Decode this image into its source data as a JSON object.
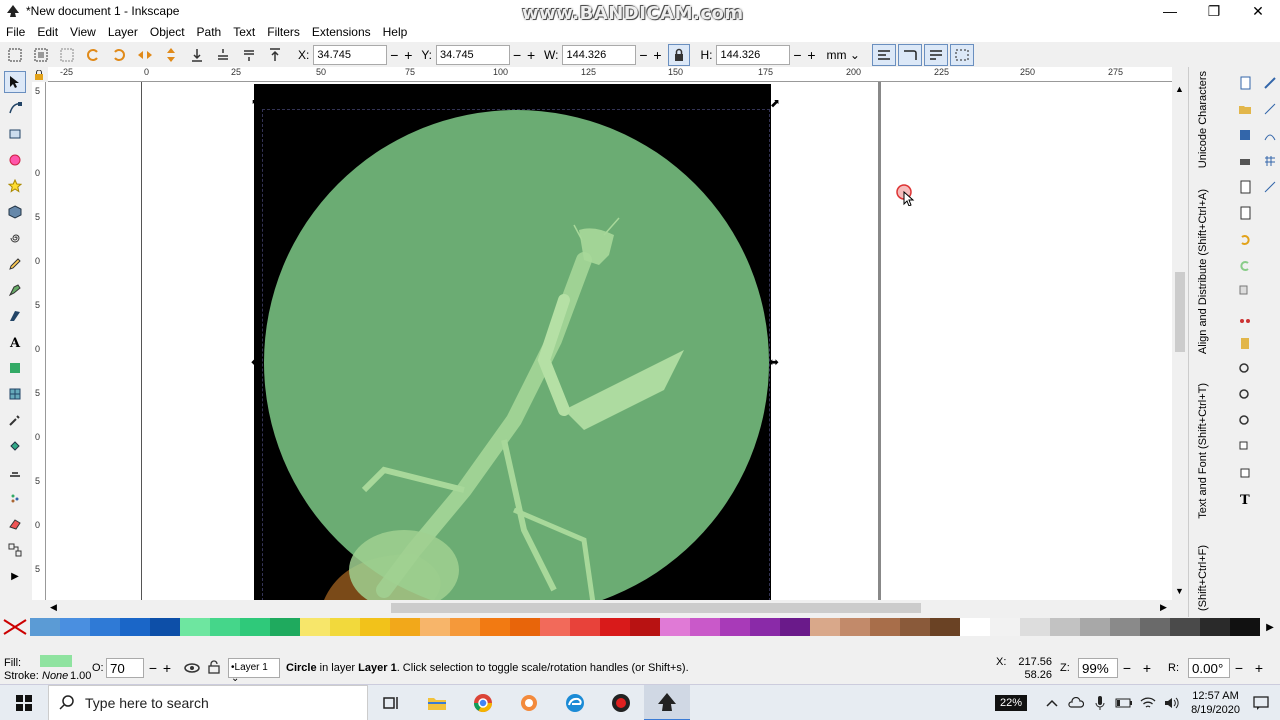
{
  "window": {
    "title": "*New document 1 - Inkscape",
    "watermark": "www.BANDICAM.com",
    "minimize": "—",
    "maximize": "❐",
    "close": "✕"
  },
  "menu": [
    "File",
    "Edit",
    "View",
    "Layer",
    "Object",
    "Path",
    "Text",
    "Filters",
    "Extensions",
    "Help"
  ],
  "toolbar": {
    "x_label": "X:",
    "x_value": "34.745",
    "y_label": "Y:",
    "y_value": "34.745",
    "w_label": "W:",
    "w_value": "144.326",
    "h_label": "H:",
    "h_value": "144.326",
    "unit": "mm",
    "minus": "−",
    "plus": "+"
  },
  "ruler": {
    "top_ticks": [
      "-25",
      "0",
      "25",
      "50",
      "75",
      "100",
      "125",
      "150",
      "175",
      "200",
      "225",
      "250",
      "275"
    ],
    "left_ticks": [
      "5",
      "0",
      "5",
      "0",
      "5",
      "0",
      "5",
      "0",
      "5",
      "0",
      "5",
      "0"
    ]
  },
  "dock_tabs": [
    "Unicode Characters",
    "Align and Distribute (Shift+Ctrl+A)",
    "Text and Font (Shift+Ctrl+T)",
    "(Shift+Ctrl+F)"
  ],
  "palette": {
    "colors": [
      "#5b9bd5",
      "#4a8fe0",
      "#2f7ad6",
      "#1a66c8",
      "#0d4fa8",
      "#6ee6a0",
      "#45d68a",
      "#2fc97a",
      "#1faa5e",
      "#f7e66a",
      "#f2d93c",
      "#f2c21a",
      "#f2a81a",
      "#f7b56a",
      "#f5993a",
      "#f27a12",
      "#e8650a",
      "#f26a5a",
      "#e8423a",
      "#d91a1a",
      "#b81212",
      "#e07ad6",
      "#c959c9",
      "#a83ab8",
      "#8a2aa8",
      "#6a1a8a",
      "#d9a88a",
      "#c28a6a",
      "#a86e4a",
      "#8a5a3a",
      "#6a4224",
      "#ffffff",
      "#f2f2f2",
      "#dddddd",
      "#c2c2c2",
      "#a8a8a8",
      "#8a8a8a",
      "#6a6a6a",
      "#4a4a4a",
      "#2a2a2a",
      "#111111"
    ]
  },
  "status": {
    "fill_label": "Fill:",
    "fill_color": "#8fe3a0",
    "stroke_label": "Stroke:",
    "stroke_value": "None",
    "stroke_width": "1.00",
    "opacity_label": "O:",
    "opacity_value": "70",
    "layer": "•Layer 1",
    "message_prefix": "Circle",
    "message_middle": "  in layer ",
    "message_layer": "Layer 1",
    "message_suffix": ". Click selection to toggle scale/rotation handles (or Shift+s).",
    "cursor_x_label": "X:",
    "cursor_x": "217.56",
    "cursor_y": "58.26",
    "zoom_label": "Z:",
    "zoom_value": "99%",
    "rotation_label": "R:",
    "rotation_value": "0.00°"
  },
  "taskbar": {
    "search_placeholder": "Type here to search",
    "battery": "22%",
    "time": "12:57 AM",
    "date": "8/19/2020"
  }
}
